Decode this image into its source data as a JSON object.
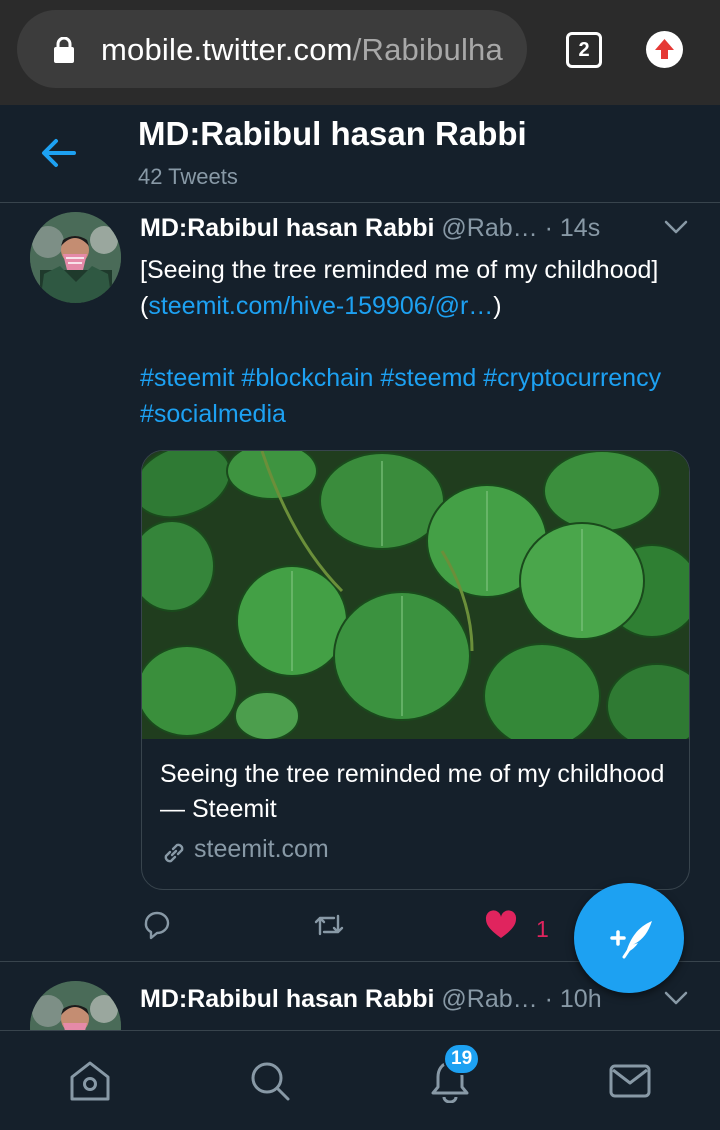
{
  "browser": {
    "url_host": "mobile.twitter.com",
    "url_path": "/Rabibulha",
    "tab_count": "2"
  },
  "header": {
    "title": "MD:Rabibul hasan Rabbi",
    "subtitle": "42 Tweets"
  },
  "tweets": [
    {
      "name": "MD:Rabibul hasan Rabbi",
      "handle": "@Rab…",
      "dot": " · ",
      "time": "14s",
      "text_before_link": "[Seeing the tree reminded me of my childhood](",
      "link_text": "steemit.com/hive-159906/@r…",
      "text_after_link": ")",
      "hashtags": "#steemit #blockchain #steemd #cryptocurrency #socialmedia",
      "card": {
        "title": "Seeing the tree reminded me of my childhood — Steemit",
        "domain": "steemit.com"
      },
      "like_count": "1"
    },
    {
      "name": "MD:Rabibul hasan Rabbi",
      "handle": "@Rab…",
      "dot": " · ",
      "time": "10h"
    }
  ],
  "bottom_nav": {
    "notifications_badge": "19",
    "items": [
      "home-icon",
      "search-icon",
      "notifications-icon",
      "messages-icon"
    ]
  },
  "colors": {
    "background": "#15202b",
    "accent": "#1da1f2",
    "like": "#e0245e",
    "muted": "#8899a6"
  }
}
